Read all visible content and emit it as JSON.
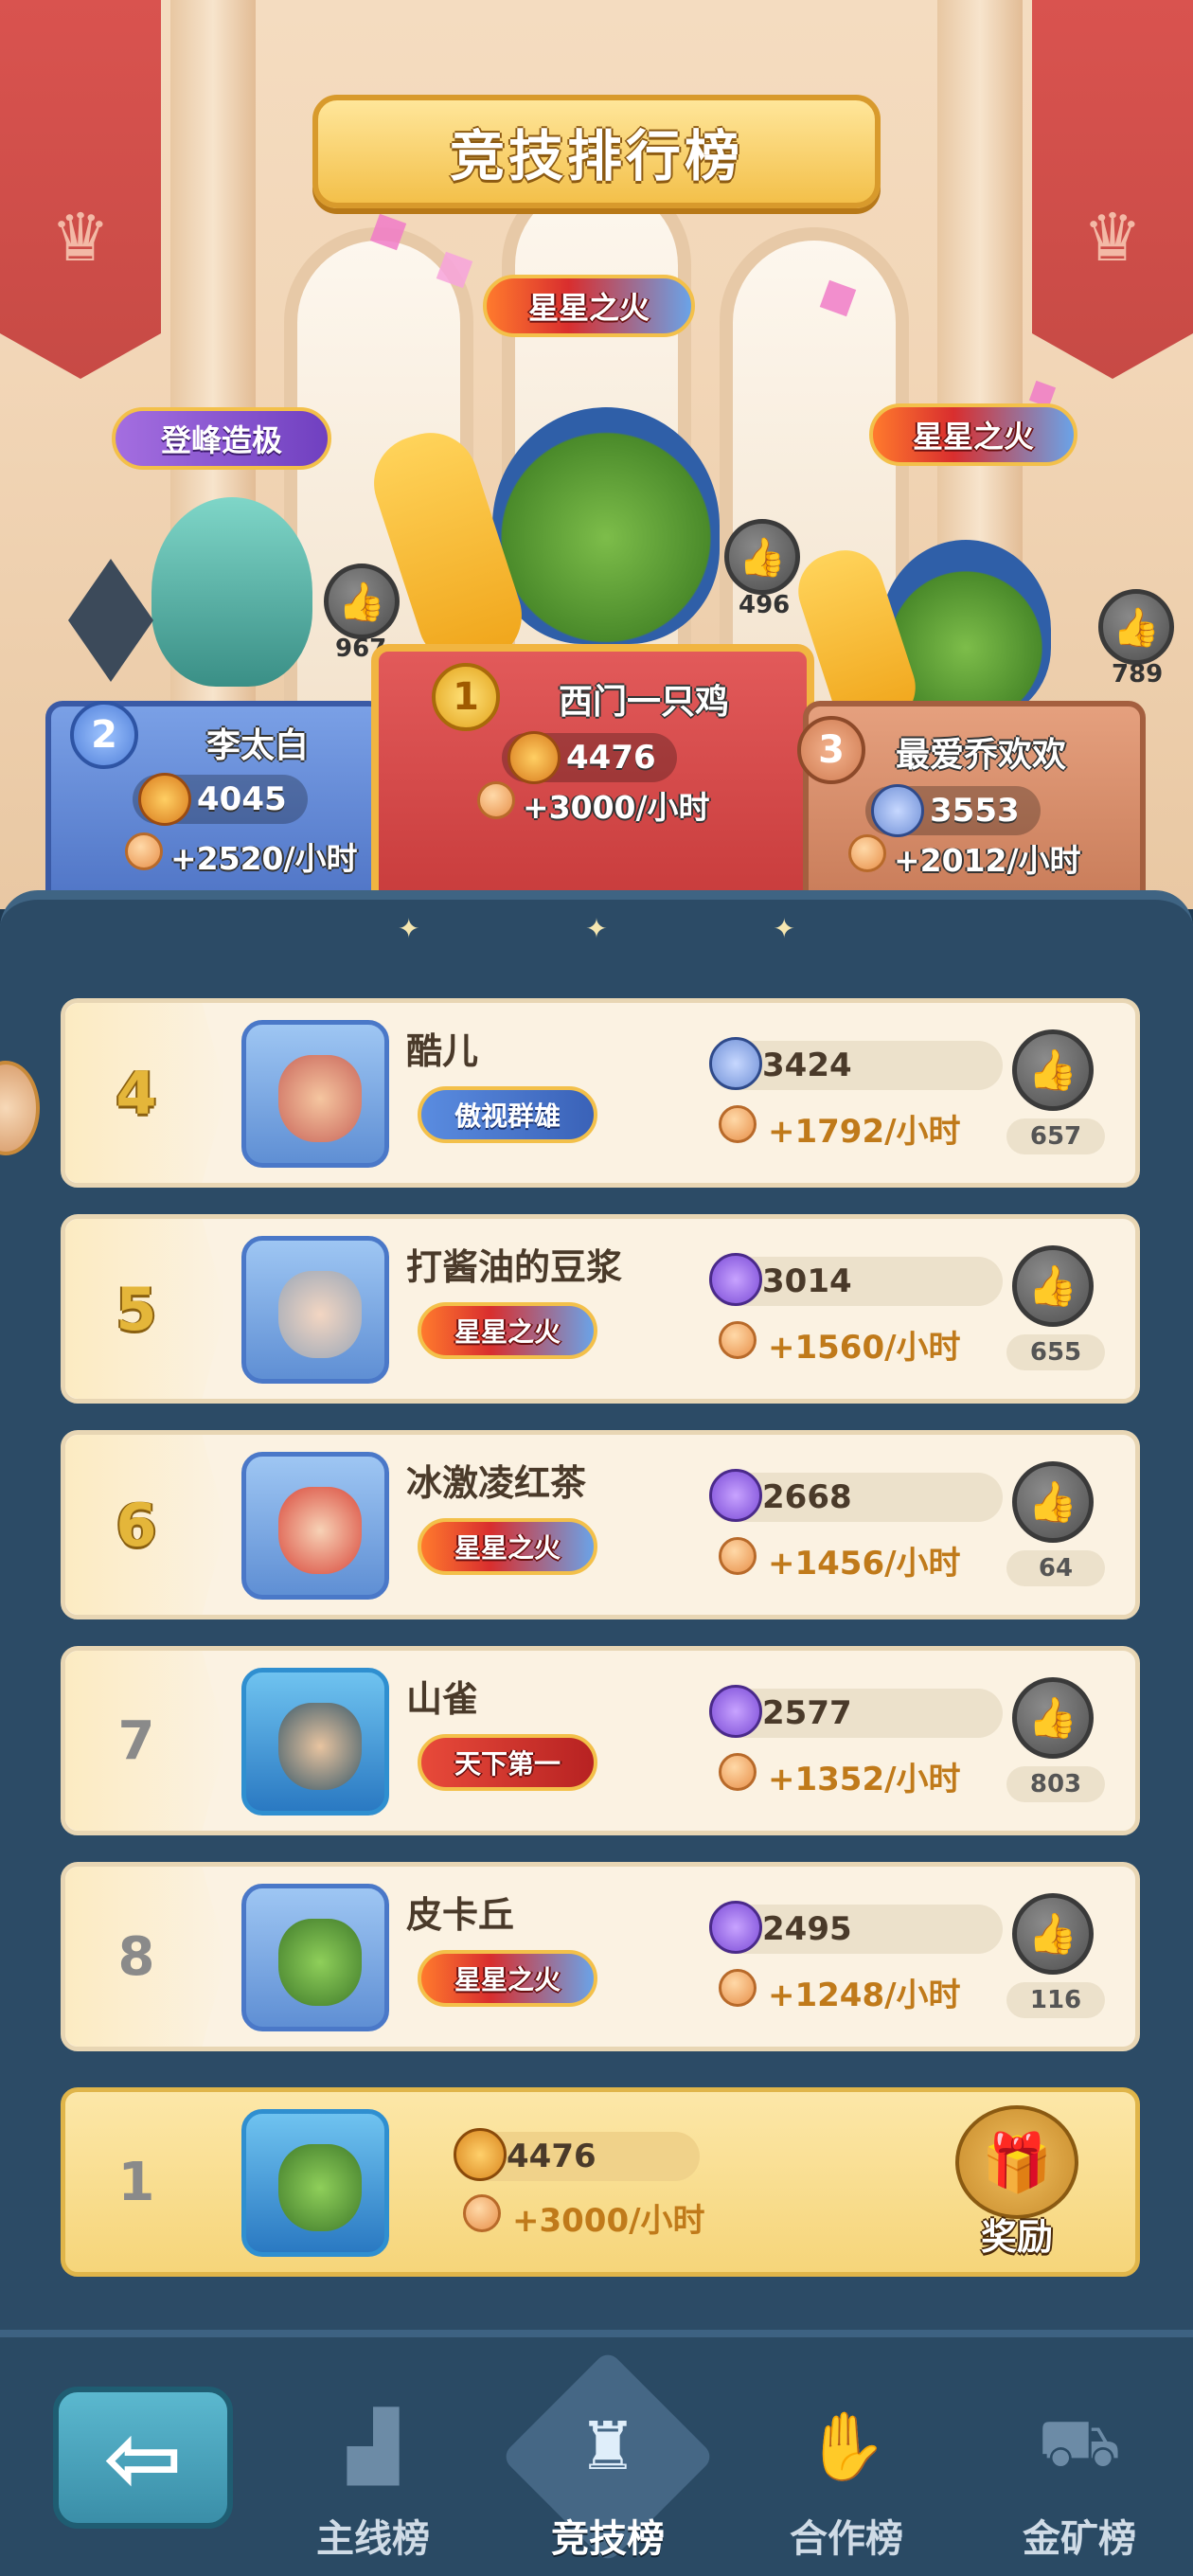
{
  "title": "竞技排行榜",
  "top3": [
    {
      "rank": "2",
      "name": "李太白",
      "title": "登峰造极",
      "score": "4045",
      "rate": "+2520/小时",
      "likes": "967"
    },
    {
      "rank": "1",
      "name": "西门一只鸡",
      "title": "星星之火",
      "score": "4476",
      "rate": "+3000/小时",
      "likes": "496"
    },
    {
      "rank": "3",
      "name": "最爱乔欢欢",
      "title": "星星之火",
      "score": "3553",
      "rate": "+2012/小时",
      "likes": "789"
    }
  ],
  "rows": [
    {
      "rank": "4",
      "name": "酷儿",
      "title": "傲视群雄",
      "score": "3424",
      "rate": "+1792/小时",
      "likes": "657"
    },
    {
      "rank": "5",
      "name": "打酱油的豆浆",
      "title": "星星之火",
      "score": "3014",
      "rate": "+1560/小时",
      "likes": "655"
    },
    {
      "rank": "6",
      "name": "冰激凌红茶",
      "title": "星星之火",
      "score": "2668",
      "rate": "+1456/小时",
      "likes": "64"
    },
    {
      "rank": "7",
      "name": "山雀",
      "title": "天下第一",
      "score": "2577",
      "rate": "+1352/小时",
      "likes": "803"
    },
    {
      "rank": "8",
      "name": "皮卡丘",
      "title": "星星之火",
      "score": "2495",
      "rate": "+1248/小时",
      "likes": "116"
    }
  ],
  "self": {
    "rank": "1",
    "score": "4476",
    "rate": "+3000/小时",
    "reward_label": "奖励"
  },
  "nav": {
    "back_icon": "back-arrow-icon",
    "tabs": [
      {
        "label": "主线榜",
        "icon": "podium-icon",
        "active": false
      },
      {
        "label": "竞技榜",
        "icon": "trophy-icon",
        "active": true
      },
      {
        "label": "合作榜",
        "icon": "handshake-icon",
        "active": false
      },
      {
        "label": "金矿榜",
        "icon": "minecart-icon",
        "active": false
      }
    ]
  },
  "colors": {
    "panel": "#2c4b66",
    "gold_text": "#c07a1a",
    "row_bg": "#fbf2e2"
  }
}
